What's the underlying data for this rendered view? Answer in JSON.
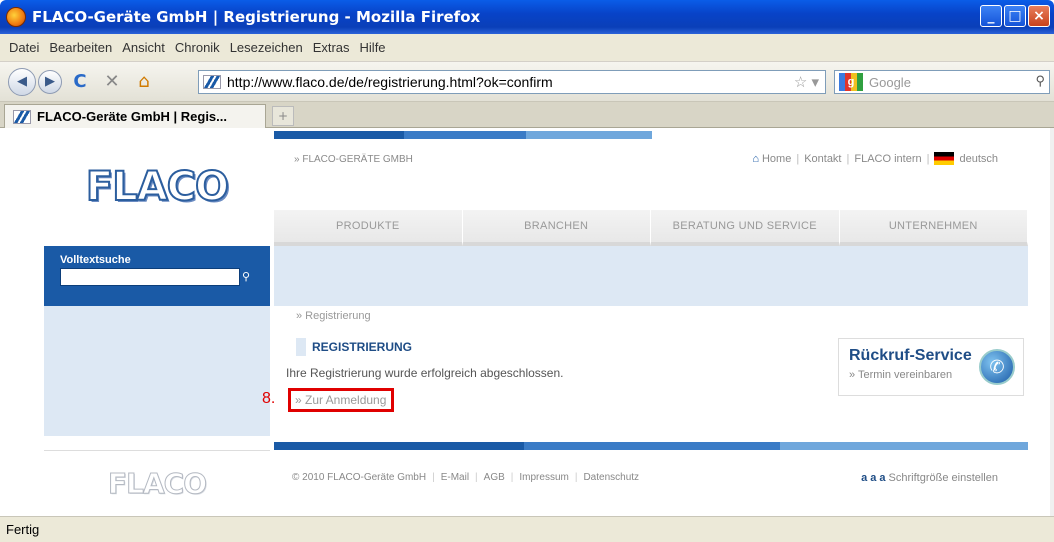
{
  "window": {
    "title": "FLACO-Geräte GmbH | Registrierung - Mozilla Firefox"
  },
  "menu": [
    "Datei",
    "Bearbeiten",
    "Ansicht",
    "Chronik",
    "Lesezeichen",
    "Extras",
    "Hilfe"
  ],
  "nav": {
    "url": "http://www.flaco.de/de/registrierung.html?ok=confirm",
    "search_placeholder": "Google"
  },
  "tab": {
    "label": "FLACO-Geräte GmbH | Regis..."
  },
  "site": {
    "logo": "FLACO",
    "company_crumb": "» FLACO-GERÄTE GMBH",
    "toplinks": {
      "home": "Home",
      "kontakt": "Kontakt",
      "intern": "FLACO intern",
      "lang": "deutsch"
    },
    "mainnav": [
      "PRODUKTE",
      "BRANCHEN",
      "BERATUNG UND SERVICE",
      "UNTERNEHMEN"
    ],
    "search_label": "Volltextsuche",
    "breadcrumb": "» Registrierung",
    "heading": "REGISTRIERUNG",
    "message": "Ihre Registrierung wurde erfolgreich abgeschlossen.",
    "login_link": "» Zur Anmeldung",
    "marker": "8.",
    "callback": {
      "title": "Rückruf-Service",
      "link": "» Termin vereinbaren"
    },
    "footer": {
      "copyright": "© 2010 FLACO-Geräte GmbH",
      "links": [
        "E-Mail",
        "AGB",
        "Impressum",
        "Datenschutz"
      ],
      "fontsize_letters": "a a a",
      "fontsize_label": "Schriftgröße einstellen"
    }
  },
  "status": "Fertig",
  "colors": {
    "brand_blue": "#1a5aa6",
    "light_blue": "#dde8f4",
    "highlight_red": "#e00000"
  }
}
